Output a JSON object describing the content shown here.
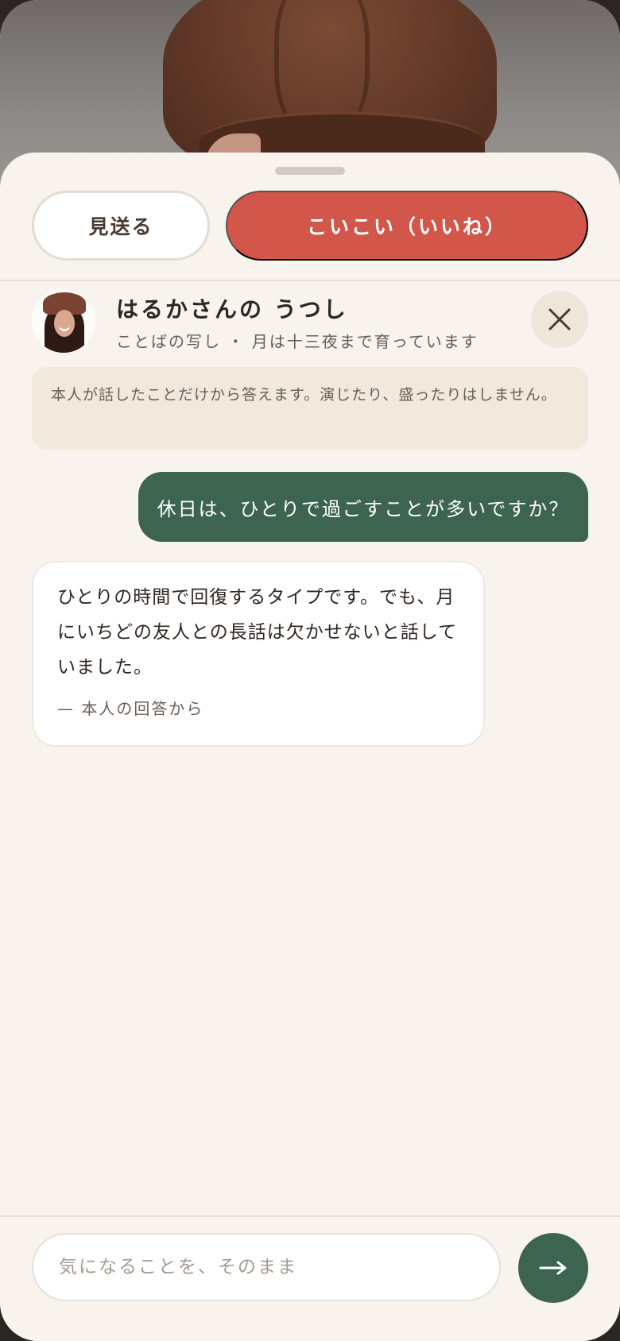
{
  "header": {
    "pass_label": "見送る",
    "like_label": "こいこい（いいね）"
  },
  "profile": {
    "name": "はるかさんの うつし",
    "subtitle": "ことばの写し ・ 月は十三夜まで育っています"
  },
  "notice": "本人が話したことだけから答えます。演じたり、盛ったりはしません。",
  "messages": [
    {
      "role": "user",
      "text": "休日は、ひとりで過ごすことが多いですか？"
    },
    {
      "role": "bot",
      "text": "ひとりの時間で回復するタイプです。でも、月にいちどの友人との長話は欠かせないと話していました。",
      "source": "— 本人の回答から"
    }
  ],
  "composer": {
    "placeholder": "気になることを、そのまま",
    "value": ""
  },
  "icons": {
    "close": "close-icon",
    "send": "arrow-right-icon"
  },
  "colors": {
    "like": "#d2564a",
    "user_bubble": "#3d6450",
    "sheet": "#f8f3ec",
    "notice": "#f1e9dc"
  }
}
